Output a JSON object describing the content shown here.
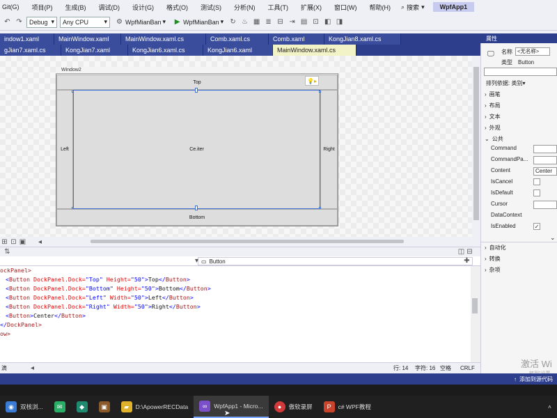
{
  "menu": {
    "items": [
      "Git(G)",
      "项目(P)",
      "生成(B)",
      "调试(D)",
      "设计(G)",
      "格式(O)",
      "测试(S)",
      "分析(N)",
      "工具(T)",
      "扩展(X)",
      "窗口(W)",
      "帮助(H)"
    ],
    "search_label": "搜索",
    "app_title": "WpfApp1"
  },
  "toolbar": {
    "config": "Debug",
    "platform": "Any CPU",
    "project": "WpfMianBan",
    "run_target": "WpfMianBan"
  },
  "tabs": {
    "row1": [
      "indow1.xaml",
      "MainWindow.xaml",
      "MainWindow.xaml.cs",
      "Comb.xaml.cs",
      "Comb.xaml",
      "KongJian8.xaml.cs"
    ],
    "row2": [
      "gJian7.xaml.cs",
      "KongJian7.xaml",
      "KongJian6.xaml.cs",
      "KongJian6.xaml",
      "MainWindow.xaml.cs"
    ]
  },
  "designer": {
    "window_title": "Window2",
    "top": "Top",
    "bottom": "Bottom",
    "left": "Left",
    "right": "Right",
    "center": "Ce.iter"
  },
  "xaml_header": {
    "element": "Button"
  },
  "code": {
    "line1": "ockPanel>",
    "line7": "DockPanel>",
    "line8": "ow>",
    "buttons": [
      {
        "attr1": "DockPanel.Dock=",
        "v1": "\"Top\"",
        "attr2": " Height=",
        "v2": "\"50\"",
        "text": "Top"
      },
      {
        "attr1": "DockPanel.Dock=",
        "v1": "\"Bottom\"",
        "attr2": " Height=",
        "v2": "\"50\"",
        "text": "Bottom"
      },
      {
        "attr1": "DockPanel.Dock=",
        "v1": "\"Left\"",
        "attr2": " Width=",
        "v2": "\"50\"",
        "text": "Left"
      },
      {
        "attr1": "DockPanel.Dock=",
        "v1": "\"Right\"",
        "attr2": " Width=",
        "v2": "\"50\"",
        "text": "Right"
      }
    ],
    "center_text": "Center",
    "tag_name": "Button"
  },
  "editor_status": {
    "left": "滴",
    "line": "行: 14",
    "char": "字符: 16",
    "space": "空格",
    "eol": "CRLF"
  },
  "properties": {
    "title": "属性",
    "name_label": "名称",
    "name_value": "<无名称>",
    "type_label": "类型",
    "type_value": "Button",
    "sort_label": "排列依据: 类别",
    "cat_brush": "画笔",
    "cat_layout": "布局",
    "cat_text": "文本",
    "cat_appearance": "外观",
    "cat_common": "公共",
    "props": [
      {
        "label": "Command",
        "value": ""
      },
      {
        "label": "CommandPa...",
        "value": ""
      },
      {
        "label": "Content",
        "value": "Center"
      },
      {
        "label": "IsCancel",
        "value": ""
      },
      {
        "label": "IsDefault",
        "value": ""
      },
      {
        "label": "Cursor",
        "value": ""
      },
      {
        "label": "DataContext",
        "value": ""
      },
      {
        "label": "IsEnabled",
        "value": "✓"
      }
    ],
    "cat_automation": "自动化",
    "cat_transform": "转换",
    "cat_misc": "杂项"
  },
  "statusbar": {
    "text": "添加到源代码"
  },
  "watermark": {
    "line1": "激活 Wi",
    "line2": "转到\"设置"
  },
  "taskbar": [
    {
      "label": "双核浏...",
      "icon": "browser-icon",
      "color": "#3a7bd5"
    },
    {
      "label": "",
      "icon": "wechat-icon",
      "color": "#2aae67"
    },
    {
      "label": "",
      "icon": "app-green-icon",
      "color": "#1f8a70"
    },
    {
      "label": "",
      "icon": "app-brown-icon",
      "color": "#8a5a2b"
    },
    {
      "label": "D:\\ApowerRECData",
      "icon": "folder-icon",
      "color": "#e0b12a"
    },
    {
      "label": "WpfApp1 - Micro...",
      "icon": "vs-icon",
      "color": "#7b4fc9"
    },
    {
      "label": "傲软录屏",
      "icon": "record-icon",
      "color": "#d23a3a"
    },
    {
      "label": "c# WPF教程",
      "icon": "ppt-icon",
      "color": "#c9442a"
    }
  ]
}
